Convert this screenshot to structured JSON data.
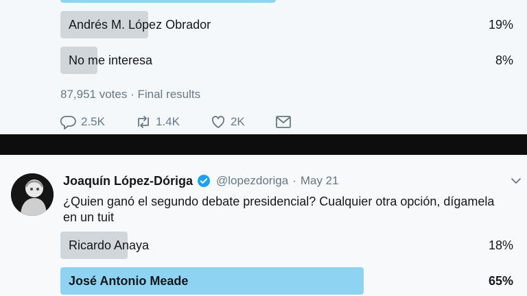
{
  "top_poll": {
    "options": [
      {
        "label": "Andrés M. López Obrador",
        "percent": "19%"
      },
      {
        "label": "No me interesa",
        "percent": "8%"
      }
    ],
    "meta": "87,951 votes · Final results",
    "actions": {
      "replies": "2.5K",
      "retweets": "1.4K",
      "likes": "2K"
    }
  },
  "tweet": {
    "author": "Joaquín López-Dóriga",
    "handle": "@lopezdoriga",
    "separator": "·",
    "date": "May 21",
    "text": "¿Quien ganó el segundo debate presidencial? Cualquier otra opción, dígamela en un tuit",
    "options": [
      {
        "label": "Ricardo Anaya",
        "percent": "18%"
      },
      {
        "label": "José Antonio Meade",
        "percent": "65%"
      }
    ]
  },
  "colors": {
    "bar_gray": "#d0d6da",
    "bar_winner": "#8fd3f2",
    "verified_blue": "#1da1f2",
    "secondary_text": "#657786"
  },
  "icons": [
    "reply-icon",
    "retweet-icon",
    "like-icon",
    "direct-message-icon",
    "verified-badge-icon",
    "chevron-down-icon"
  ]
}
